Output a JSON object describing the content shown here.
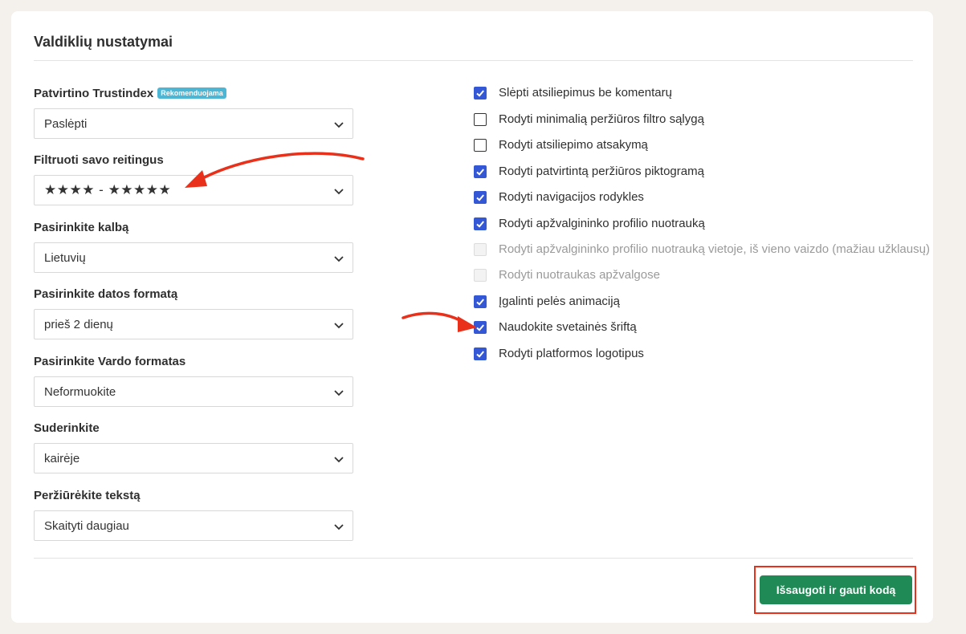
{
  "panel": {
    "title": "Valdiklių nustatymai"
  },
  "fields": [
    {
      "label": "Patvirtino Trustindex",
      "badge": "Rekomenduojama",
      "value": "Paslėpti"
    },
    {
      "label": "Filtruoti savo reitingus",
      "value": "★★★★ - ★★★★★"
    },
    {
      "label": "Pasirinkite kalbą",
      "value": "Lietuvių"
    },
    {
      "label": "Pasirinkite datos formatą",
      "value": "prieš 2 dienų"
    },
    {
      "label": "Pasirinkite Vardo formatas",
      "value": "Neformuokite"
    },
    {
      "label": "Suderinkite",
      "value": "kairėje"
    },
    {
      "label": "Peržiūrėkite tekstą",
      "value": "Skaityti daugiau"
    }
  ],
  "options": [
    {
      "label": "Slėpti atsiliepimus be komentarų",
      "state": "checked"
    },
    {
      "label": "Rodyti minimalią peržiūros filtro sąlygą",
      "state": "unchecked"
    },
    {
      "label": "Rodyti atsiliepimo atsakymą",
      "state": "unchecked"
    },
    {
      "label": "Rodyti patvirtintą peržiūros piktogramą",
      "state": "checked"
    },
    {
      "label": "Rodyti navigacijos rodykles",
      "state": "checked"
    },
    {
      "label": "Rodyti apžvalgininko profilio nuotrauką",
      "state": "checked"
    },
    {
      "label": "Rodyti apžvalgininko profilio nuotrauką vietoje, iš vieno vaizdo (mažiau užklausų)",
      "state": "disabled"
    },
    {
      "label": "Rodyti nuotraukas apžvalgose",
      "state": "disabled"
    },
    {
      "label": "Įgalinti pelės animaciją",
      "state": "checked"
    },
    {
      "label": "Naudokite svetainės šriftą",
      "state": "checked"
    },
    {
      "label": "Rodyti platformos logotipus",
      "state": "checked"
    }
  ],
  "actions": {
    "save_label": "Išsaugoti ir gauti kodą"
  },
  "colors": {
    "accent": "#3457d5",
    "save_button": "#1f8a55",
    "annotation": "#e8301b",
    "badge": "#4cb6d4"
  }
}
